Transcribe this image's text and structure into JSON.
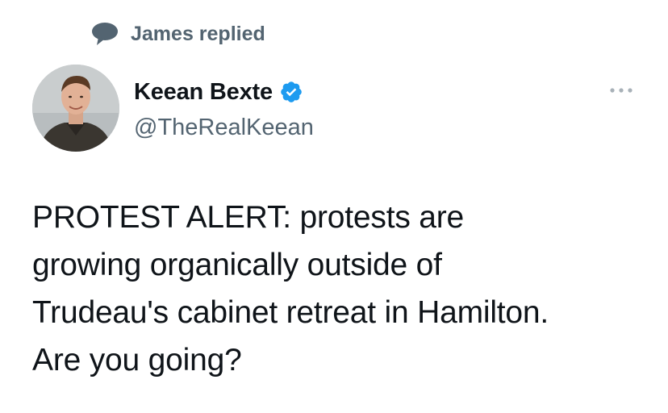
{
  "social_context": {
    "icon": "reply-bubble-icon",
    "label": "James replied"
  },
  "author": {
    "display_name": "Keean Bexte",
    "verified": true,
    "verified_icon": "verified-badge-icon",
    "handle": "@TheRealKeean"
  },
  "menu": {
    "icon": "more-options-icon"
  },
  "tweet": {
    "text": "PROTEST ALERT: protests are\ngrowing organically outside of\nTrudeau's cabinet retreat in Hamilton.\nAre you going?"
  },
  "colors": {
    "primary_text": "#0f1419",
    "secondary_text": "#536471",
    "verified_blue": "#1d9bf0",
    "background": "#ffffff"
  }
}
